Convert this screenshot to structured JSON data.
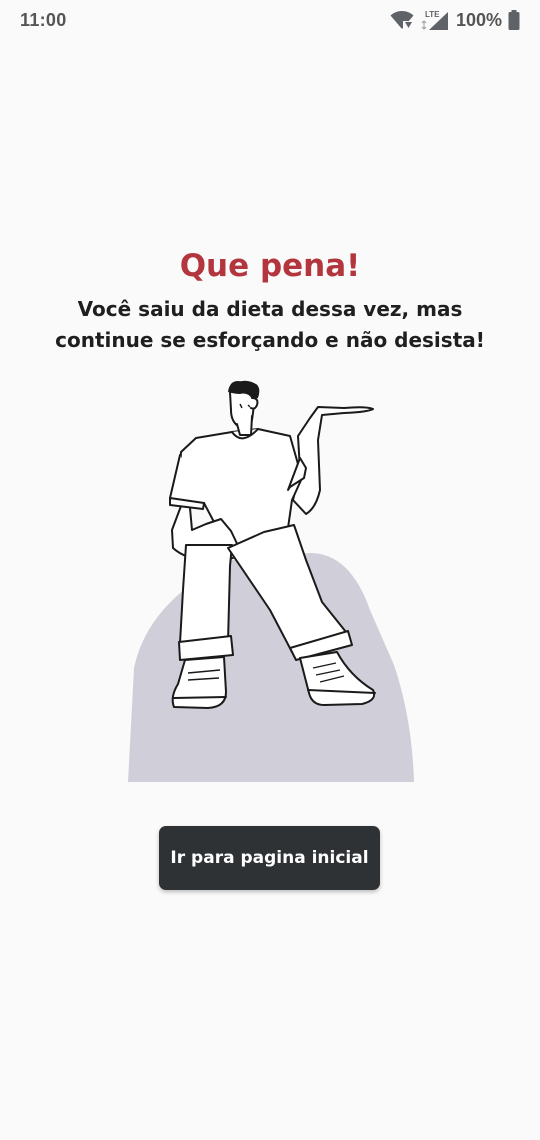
{
  "status_bar": {
    "time": "11:00",
    "network_label": "LTE",
    "battery_text": "100%",
    "icons": [
      "wifi-icon",
      "cell-signal-icon",
      "battery-icon"
    ]
  },
  "result": {
    "title": "Que pena!",
    "message": "Você saiu da dieta dessa vez, mas continue se esforçando e não desista!"
  },
  "illustration": {
    "icon": "sitting-person-shrug-illustration"
  },
  "actions": {
    "home_button_label": "Ir para pagina inicial"
  },
  "colors": {
    "title": "#b3353e",
    "button_background": "#2f3235",
    "button_text": "#ffffff",
    "background": "#fafafa",
    "rock": "#d0ced8"
  }
}
